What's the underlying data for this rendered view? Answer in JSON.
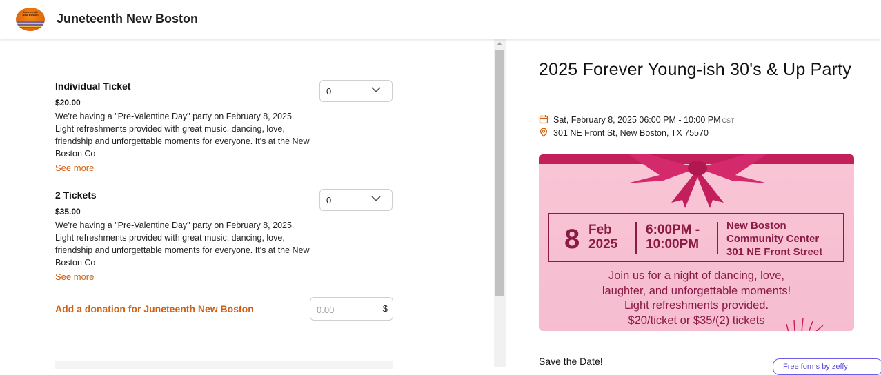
{
  "header": {
    "logo_text": "Juneteenth New Boston",
    "org_name": "Juneteenth New Boston"
  },
  "tickets": [
    {
      "name": "Individual Ticket",
      "price": "$20.00",
      "description": "We're having a \"Pre-Valentine Day\" party on February 8, 2025. Light refreshments provided with great music, dancing, love, friendship and unforgettable moments for everyone. It's at the New Boston Co",
      "see_more": "See more",
      "quantity": "0"
    },
    {
      "name": "2 Tickets",
      "price": "$35.00",
      "description": "We're having a \"Pre-Valentine Day\" party on February 8, 2025. Light refreshments provided with great music, dancing, love, friendship and unforgettable moments for everyone. It's at the New Boston Co",
      "see_more": "See more",
      "quantity": "0"
    }
  ],
  "donation": {
    "label": "Add a donation for Juneteenth New Boston",
    "placeholder": "0.00",
    "currency": "$"
  },
  "event": {
    "title": "2025 Forever Young-ish 30's & Up Party",
    "datetime": "Sat, February 8, 2025 06:00 PM - 10:00 PM",
    "timezone": "CST",
    "address": "301 NE Front St, New Boston, TX 75570",
    "save_the_date": "Save the Date!"
  },
  "flyer": {
    "day": "8",
    "month": "Feb",
    "year": "2025",
    "time_start": "6:00PM -",
    "time_end": "10:00PM",
    "place_line1": "New Boston",
    "place_line2": "Community Center",
    "place_line3": "301 NE Front Street",
    "msg_line1": "Join us for a night of dancing, love,",
    "msg_line2": "laughter, and unforgettable moments!",
    "msg_line3": "Light refreshments provided.",
    "msg_line4": "$20/ticket or $35/(2) tickets"
  },
  "badge": {
    "text": "Free forms by zeffy"
  },
  "colors": {
    "accent": "#d2600f",
    "flyer_pink": "#f7c0d2",
    "flyer_text": "#8b1a45",
    "ribbon": "#c31f5d",
    "zeffy": "#6c5ce7"
  }
}
